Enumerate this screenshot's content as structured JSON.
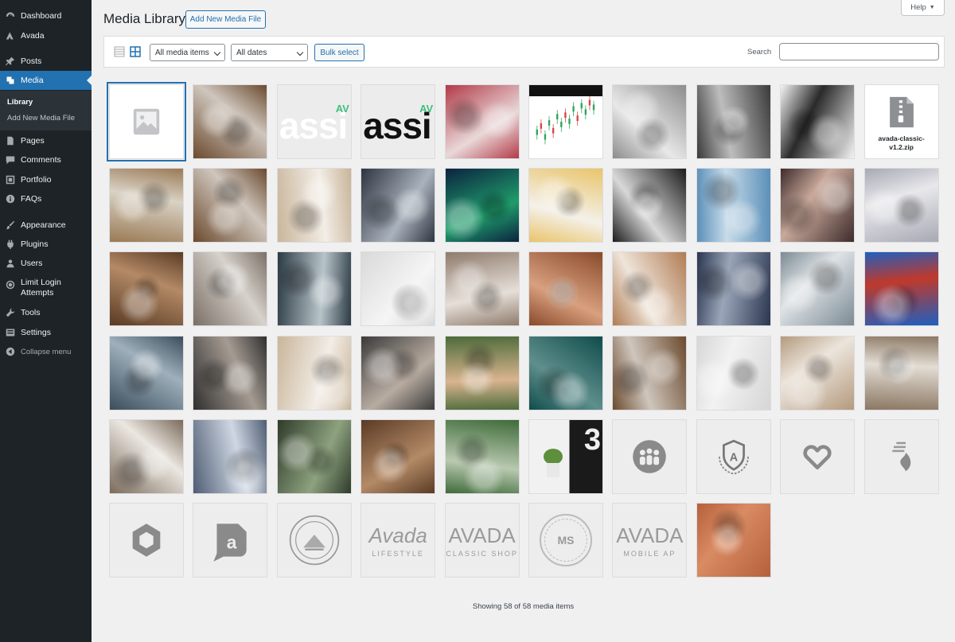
{
  "sidebar": {
    "items": [
      {
        "label": "Dashboard",
        "icon": "dashboard-icon"
      },
      {
        "label": "Avada",
        "icon": "avada-icon"
      },
      {
        "label": "Posts",
        "icon": "pin-icon"
      },
      {
        "label": "Media",
        "icon": "media-icon"
      },
      {
        "label": "Pages",
        "icon": "pages-icon"
      },
      {
        "label": "Comments",
        "icon": "comments-icon"
      },
      {
        "label": "Portfolio",
        "icon": "portfolio-icon"
      },
      {
        "label": "FAQs",
        "icon": "info-icon"
      },
      {
        "label": "Appearance",
        "icon": "brush-icon"
      },
      {
        "label": "Plugins",
        "icon": "plugin-icon"
      },
      {
        "label": "Users",
        "icon": "users-icon"
      },
      {
        "label": "Limit Login\nAttempts",
        "icon": "limit-login-icon"
      },
      {
        "label": "Tools",
        "icon": "wrench-icon"
      },
      {
        "label": "Settings",
        "icon": "settings-icon"
      }
    ],
    "submenu": [
      "Library",
      "Add New Media File"
    ],
    "collapse_label": "Collapse menu"
  },
  "header": {
    "title": "Media Library",
    "add_new_label": "Add New Media File",
    "help_label": "Help"
  },
  "toolbar": {
    "filter_type": "All media items",
    "filter_date": "All dates",
    "bulk_select_label": "Bulk select",
    "search_label": "Search",
    "search_value": ""
  },
  "tiles": [
    {
      "kind": "placeholder"
    },
    {
      "kind": "photo",
      "name": "desk-laptop-photo",
      "c1": "#6b4a2e",
      "c2": "#cfc6bd"
    },
    {
      "kind": "text",
      "name": "assi-green-logo",
      "text": "assi",
      "small": "AV",
      "color": "#ffffff",
      "accent": "#3fbf7f",
      "bg": "#ececec"
    },
    {
      "kind": "text",
      "name": "assi-black-logo",
      "text": "assi",
      "small": "AV",
      "color": "#111111",
      "accent": "#3fbf7f",
      "bg": "#ececec"
    },
    {
      "kind": "photo",
      "name": "phone-trading-photo",
      "c1": "#b23a48",
      "c2": "#e9d8d8"
    },
    {
      "kind": "chart",
      "name": "stock-chart-image"
    },
    {
      "kind": "photo",
      "name": "hand-card-photo",
      "c1": "#8c8c8c",
      "c2": "#e8e8e8"
    },
    {
      "kind": "photo",
      "name": "dollar-bill-photo",
      "c1": "#3a3a3a",
      "c2": "#bdbdbd"
    },
    {
      "kind": "photo",
      "name": "notebook-pen-photo",
      "c1": "#f4f4f4",
      "c2": "#2a2a2a"
    },
    {
      "kind": "zip",
      "label": "avada-classic-\nv1.2.zip"
    },
    {
      "kind": "photo",
      "name": "office-window-photo",
      "c1": "#9a7a55",
      "c2": "#d9d2c5"
    },
    {
      "kind": "photo",
      "name": "desk-laptop-photo-2",
      "c1": "#6b4a2e",
      "c2": "#cfc6bd"
    },
    {
      "kind": "photo",
      "name": "team-whiteboard-photo",
      "c1": "#c9b59a",
      "c2": "#f2ede6"
    },
    {
      "kind": "photo",
      "name": "wall-street-sign-photo",
      "c1": "#2e3440",
      "c2": "#a9b2bd"
    },
    {
      "kind": "photo",
      "name": "green-chart-screen-photo",
      "c1": "#0b2340",
      "c2": "#1f9c6b"
    },
    {
      "kind": "photo",
      "name": "sticky-notes-board-photo",
      "c1": "#e9c46a",
      "c2": "#f4f1ea"
    },
    {
      "kind": "photo",
      "name": "modern-building-photo",
      "c1": "#1c1c1c",
      "c2": "#d8d8d8"
    },
    {
      "kind": "photo",
      "name": "skyscraper-photo",
      "c1": "#5b8fb9",
      "c2": "#c7dbe9"
    },
    {
      "kind": "photo",
      "name": "laptop-code-photo",
      "c1": "#3d2b2b",
      "c2": "#c9a99b"
    },
    {
      "kind": "photo",
      "name": "tablet-desk-photo",
      "c1": "#a7a9b3",
      "c2": "#e8e8ec"
    },
    {
      "kind": "photo",
      "name": "meeting-table-top-photo",
      "c1": "#5a3b25",
      "c2": "#b48a66"
    },
    {
      "kind": "photo",
      "name": "man-laptop-photo",
      "c1": "#7a6f66",
      "c2": "#d7d2cc"
    },
    {
      "kind": "photo",
      "name": "laptop-typing-photo",
      "c1": "#2b3a44",
      "c2": "#b8c4c9"
    },
    {
      "kind": "photo",
      "name": "laptop-white-desk-photo",
      "c1": "#d9d9d9",
      "c2": "#f5f5f5"
    },
    {
      "kind": "photo",
      "name": "two-people-office-photo",
      "c1": "#8e7b6c",
      "c2": "#e6dfd8"
    },
    {
      "kind": "photo",
      "name": "woman-smiling-photo",
      "c1": "#8a4a2c",
      "c2": "#d8a07e"
    },
    {
      "kind": "photo",
      "name": "woman-glasses-photo",
      "c1": "#b07c54",
      "c2": "#efe5da"
    },
    {
      "kind": "photo",
      "name": "man-suit-photo",
      "c1": "#2a3550",
      "c2": "#9aa6b8"
    },
    {
      "kind": "photo",
      "name": "surface-laptop-photo",
      "c1": "#7b8a94",
      "c2": "#dfe3e6"
    },
    {
      "kind": "photo",
      "name": "windows-laptop-red-photo",
      "c1": "#1f5fbf",
      "c2": "#c0392b"
    },
    {
      "kind": "photo",
      "name": "man-vest-photo",
      "c1": "#3b4d5c",
      "c2": "#9fb0bc"
    },
    {
      "kind": "photo",
      "name": "woman-car-laptop-photo",
      "c1": "#2f2f2f",
      "c2": "#a59b92"
    },
    {
      "kind": "photo",
      "name": "team-whiteboard-photo-2",
      "c1": "#c9b59a",
      "c2": "#f2ede6"
    },
    {
      "kind": "photo",
      "name": "woman-car-photo",
      "c1": "#3a3a3a",
      "c2": "#b8aca1"
    },
    {
      "kind": "photo",
      "name": "friends-laughing-photo",
      "c1": "#4d6b3a",
      "c2": "#d9b48f"
    },
    {
      "kind": "photo",
      "name": "man-phone-teal-photo",
      "c1": "#0f4c4c",
      "c2": "#5f8f8c"
    },
    {
      "kind": "photo",
      "name": "desk-laptop-photo-3",
      "c1": "#6b4a2e",
      "c2": "#cfc6bd"
    },
    {
      "kind": "photo",
      "name": "laptop-coffee-photo",
      "c1": "#d6d6d6",
      "c2": "#f2f2f2"
    },
    {
      "kind": "photo",
      "name": "office-team-photo",
      "c1": "#b49a7e",
      "c2": "#ece5dc"
    },
    {
      "kind": "photo",
      "name": "colleagues-laptop-photo",
      "c1": "#8b7763",
      "c2": "#e3ddd4"
    },
    {
      "kind": "photo",
      "name": "reports-desk-photo",
      "c1": "#7a6a5a",
      "c2": "#ebe7e1"
    },
    {
      "kind": "photo",
      "name": "tablet-charts-photo",
      "c1": "#4f5d73",
      "c2": "#cfd7e3"
    },
    {
      "kind": "photo",
      "name": "people-sitting-photo",
      "c1": "#2e3b2a",
      "c2": "#8da27e"
    },
    {
      "kind": "photo",
      "name": "meeting-table-top-photo-2",
      "c1": "#5a3b25",
      "c2": "#b48a66"
    },
    {
      "kind": "photo",
      "name": "green-building-photo",
      "c1": "#3f6b3a",
      "c2": "#b9c9b0"
    },
    {
      "kind": "clock",
      "name": "plant-clock-photo",
      "digit": "3"
    },
    {
      "kind": "logo",
      "name": "people-circle-logo",
      "shape": "people"
    },
    {
      "kind": "logo",
      "name": "crest-logo",
      "shape": "crest"
    },
    {
      "kind": "logo",
      "name": "heart-logo",
      "shape": "heart"
    },
    {
      "kind": "logo",
      "name": "flame-logo",
      "shape": "flame"
    },
    {
      "kind": "logo",
      "name": "hexagon-logo",
      "shape": "hex"
    },
    {
      "kind": "logo",
      "name": "a-bubble-logo",
      "shape": "abubble"
    },
    {
      "kind": "logo",
      "name": "emblem-logo",
      "shape": "emblem"
    },
    {
      "kind": "wordmark",
      "name": "avada-lifestyle-logo",
      "line1": "Avada",
      "line2": "LIFESTYLE",
      "italic": true
    },
    {
      "kind": "wordmark",
      "name": "avada-classic-shop-logo",
      "line1": "AVADA",
      "line2": "CLASSIC SHOP",
      "italic": false
    },
    {
      "kind": "ms",
      "name": "ms-badge-logo",
      "text": "MS"
    },
    {
      "kind": "wordmark",
      "name": "avada-mobile-app-logo",
      "line1": "AVADA",
      "line2": "MOBILE AP",
      "italic": false
    },
    {
      "kind": "photo",
      "name": "terracotta-table-photo",
      "c1": "#b5603c",
      "c2": "#d98b62"
    }
  ],
  "footer": {
    "count_text": "Showing 58 of 58 media items"
  }
}
